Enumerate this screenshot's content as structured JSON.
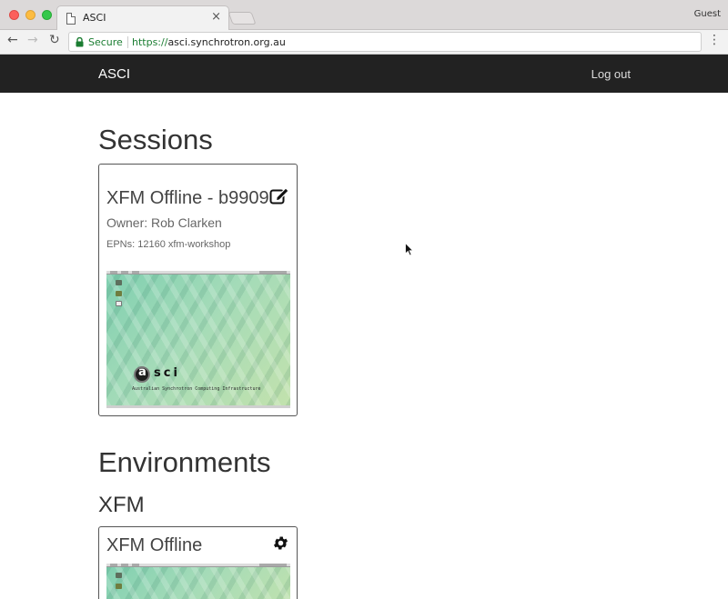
{
  "browser": {
    "tab_title": "ASCI",
    "tab_close": "×",
    "profile": "Guest",
    "secure_label": "Secure",
    "url_scheme": "https://",
    "url_rest": "asci.synchrotron.org.au"
  },
  "navbar": {
    "brand": "ASCI",
    "logout": "Log out"
  },
  "sessions": {
    "heading": "Sessions",
    "items": [
      {
        "title": "XFM Offline - b9909",
        "owner": "Owner: Rob Clarken",
        "epns": "EPNs: 12160 xfm-workshop",
        "thumb_logo": "sci",
        "thumb_caption": "Australian Synchrotron Computing Infrastructure"
      }
    ]
  },
  "environments": {
    "heading": "Environments",
    "groups": [
      {
        "name": "XFM",
        "items": [
          {
            "title": "XFM Offline"
          }
        ]
      }
    ]
  },
  "icons": {
    "edit": "edit-icon",
    "settings": "gear-icon",
    "lock": "lock-icon"
  },
  "colors": {
    "navbar_bg": "#222222",
    "secure_green": "#1b7d32"
  }
}
